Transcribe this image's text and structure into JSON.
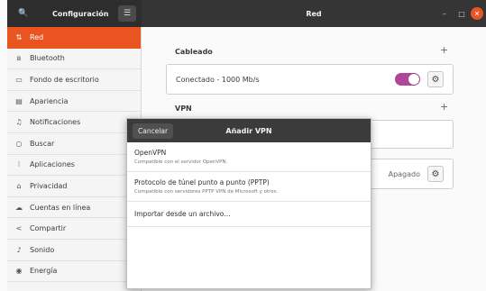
{
  "header": {
    "app_title": "Configuración",
    "window_title": "Red",
    "search_glyph": "🔍",
    "menu_glyph": "☰",
    "minimize_glyph": "–",
    "maximize_glyph": "□",
    "close_glyph": "✕"
  },
  "sidebar": {
    "items": [
      {
        "label": "Red",
        "icon": "network-icon",
        "glyph": "⇅",
        "active": true
      },
      {
        "label": "Bluetooth",
        "icon": "bluetooth-icon",
        "glyph": "ʙ"
      },
      {
        "label": "Fondo de escritorio",
        "icon": "wallpaper-icon",
        "glyph": "▭"
      },
      {
        "label": "Apariencia",
        "icon": "appearance-icon",
        "glyph": "▤"
      },
      {
        "label": "Notificaciones",
        "icon": "bell-icon",
        "glyph": "♫"
      },
      {
        "label": "Buscar",
        "icon": "search-icon",
        "glyph": "○"
      },
      {
        "label": "Aplicaciones",
        "icon": "apps-icon",
        "glyph": "⁝"
      },
      {
        "label": "Privacidad",
        "icon": "lock-icon",
        "glyph": "⌂"
      },
      {
        "label": "Cuentas en línea",
        "icon": "cloud-icon",
        "glyph": "☁"
      },
      {
        "label": "Compartir",
        "icon": "share-icon",
        "glyph": "<"
      },
      {
        "label": "Sonido",
        "icon": "music-icon",
        "glyph": "♪"
      },
      {
        "label": "Energía",
        "icon": "power-icon",
        "glyph": "◉"
      }
    ]
  },
  "main": {
    "wired": {
      "title": "Cableado",
      "add": "+",
      "status": "Conectado - 1000 Mb/s",
      "toggle_on": true,
      "gear_glyph": "⚙"
    },
    "vpn": {
      "title": "VPN",
      "add": "+"
    },
    "proxy": {
      "status": "Apagado",
      "gear_glyph": "⚙"
    }
  },
  "dialog": {
    "cancel_label": "Cancelar",
    "title": "Añadir VPN",
    "options": [
      {
        "title": "OpenVPN",
        "subtitle": "Compatible con el servidor OpenVPN."
      },
      {
        "title": "Protocolo de túnel punto a punto (PPTP)",
        "subtitle": "Compatible con servidores PPTP VPN de Microsoft y otros."
      },
      {
        "title": "Importar desde un archivo…",
        "subtitle": ""
      }
    ]
  }
}
